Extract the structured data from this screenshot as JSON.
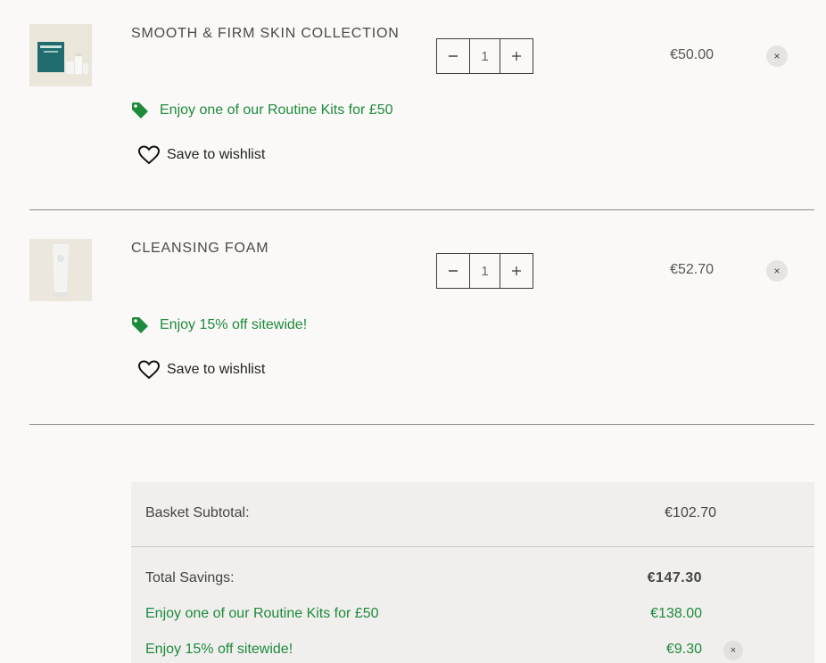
{
  "colors": {
    "promo_green": "#1e8a3c",
    "background": "#faf9f7",
    "summary_bg": "#f0efed"
  },
  "items": [
    {
      "name": "SMOOTH & FIRM SKIN COLLECTION",
      "quantity": "1",
      "minus_icon": "minus-icon",
      "plus_icon": "plus-icon",
      "price": "€50.00",
      "remove_glyph": "×",
      "promo": "Enjoy one of our Routine Kits for £50",
      "wishlist_label": "Save to wishlist"
    },
    {
      "name": "CLEANSING FOAM",
      "quantity": "1",
      "minus_icon": "minus-icon",
      "plus_icon": "plus-icon",
      "price": "€52.70",
      "remove_glyph": "×",
      "promo": "Enjoy 15% off sitewide!",
      "wishlist_label": "Save to wishlist"
    }
  ],
  "summary": {
    "subtotal_label": "Basket Subtotal:",
    "subtotal_value": "€102.70",
    "savings_label": "Total Savings:",
    "savings_value": "€147.30",
    "promos": [
      {
        "label": "Enjoy one of our Routine Kits for £50",
        "value": "€138.00"
      },
      {
        "label": "Enjoy 15% off sitewide!",
        "value": "€9.30",
        "remove_glyph": "×"
      }
    ]
  }
}
